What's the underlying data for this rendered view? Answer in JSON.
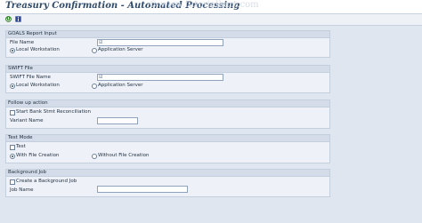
{
  "window": {
    "title": "Treasury Confirmation - Automated Processing",
    "watermark": "© www.tutorialkart.com"
  },
  "toolbar": {
    "execute_icon": "execute-icon",
    "info_icon": "info-icon"
  },
  "goals": {
    "header": "GOALS Report Input",
    "file_name_label": "File Name",
    "file_name_value": "",
    "radio_local": "Local Workstation",
    "radio_server": "Application Server",
    "selected": "Local Workstation"
  },
  "swift": {
    "header": "SWIFT File",
    "file_name_label": "SWIFT File Name",
    "file_name_value": "",
    "radio_local": "Local Workstation",
    "radio_server": "Application Server",
    "selected": "Local Workstation"
  },
  "followup": {
    "header": "Follow up action",
    "checkbox_label": "Start Bank Stmt Reconciliation",
    "checkbox_checked": false,
    "variant_label": "Variant Name",
    "variant_value": ""
  },
  "testmode": {
    "header": "Test Mode",
    "checkbox_label": "Test",
    "checkbox_checked": false,
    "radio_with": "With File Creation",
    "radio_without": "Without File Creation",
    "selected": "With File Creation"
  },
  "background": {
    "header": "Background Job",
    "checkbox_label": "Create a Background Job",
    "checkbox_checked": false,
    "job_label": "Job Name",
    "job_value": ""
  },
  "colors": {
    "background": "#dfe6ef",
    "group_header": "#d3dce8",
    "title_text": "#2f4a6b"
  }
}
